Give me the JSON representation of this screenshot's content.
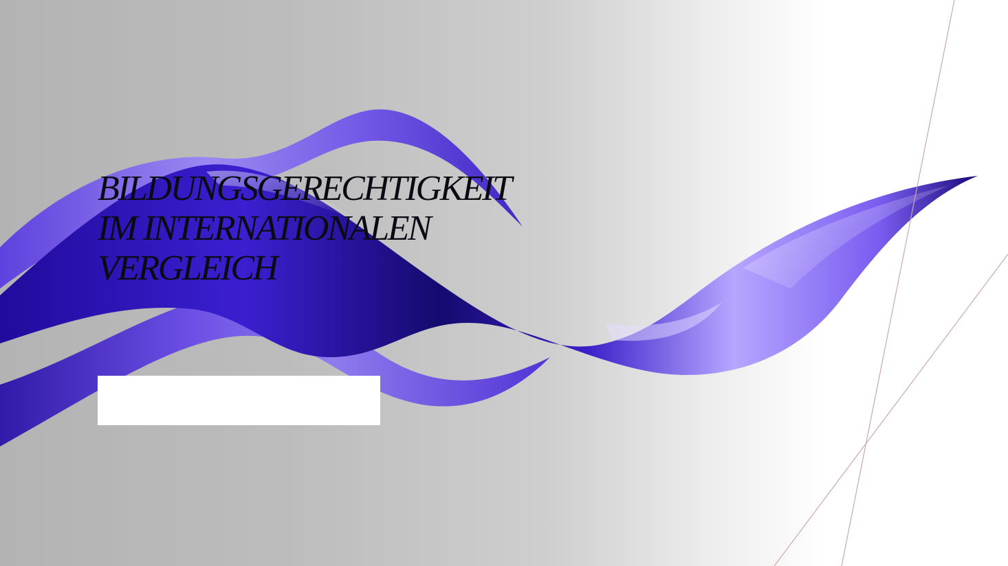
{
  "slide": {
    "title_lines": [
      "BILDUNGSGERECHTIGKEIT",
      "IM INTERNATIONALEN",
      "VERGLEICH"
    ],
    "subtitle": ""
  },
  "colors": {
    "ribbon_dark": "#1c0a8a",
    "ribbon_mid": "#4b2bd6",
    "ribbon_light": "#b7a6ff",
    "line_color": "#c9a9ac",
    "title_color": "#0a0a12"
  },
  "icons": [
    "ribbon-graphic",
    "decorative-lines"
  ]
}
